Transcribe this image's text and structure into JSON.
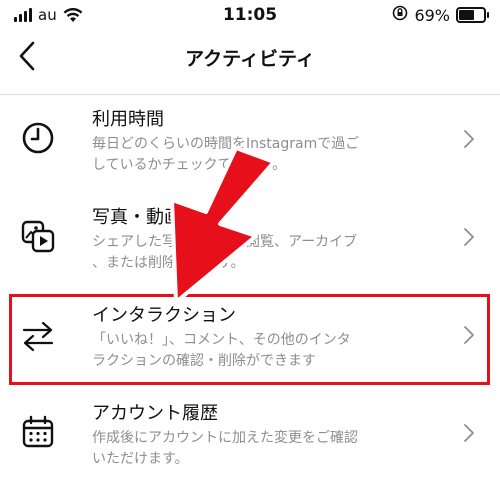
{
  "status_bar": {
    "carrier": "au",
    "time": "11:05",
    "battery_percent": "69%",
    "battery_level": 0.69
  },
  "nav": {
    "title": "アクティビティ",
    "back_icon": "chevron-left-icon"
  },
  "items": [
    {
      "icon": "clock-icon",
      "title": "利用時間",
      "desc_line1": "毎日どのくらいの時間をInstagramで過ご",
      "desc_line2": "しているかチェックできます。"
    },
    {
      "icon": "photos-videos-icon",
      "title": "写真・動画",
      "desc_line1": "シェアした写真や動画を閲覧、アーカイブ",
      "desc_line2": "、または削除できます。"
    },
    {
      "icon": "interactions-arrows-icon",
      "title": "インタラクション",
      "desc_line1": "「いいね！」、コメント、その他のインタ",
      "desc_line2": "ラクションの確認・削除ができます"
    },
    {
      "icon": "calendar-icon",
      "title": "アカウント履歴",
      "desc_line1": "作成後にアカウントに加えた変更をご確認",
      "desc_line2": "いただけます。"
    }
  ],
  "colors": {
    "highlight": "#e5101a",
    "arrow": "#e5101a",
    "secondary_text": "#8e8e8e"
  }
}
